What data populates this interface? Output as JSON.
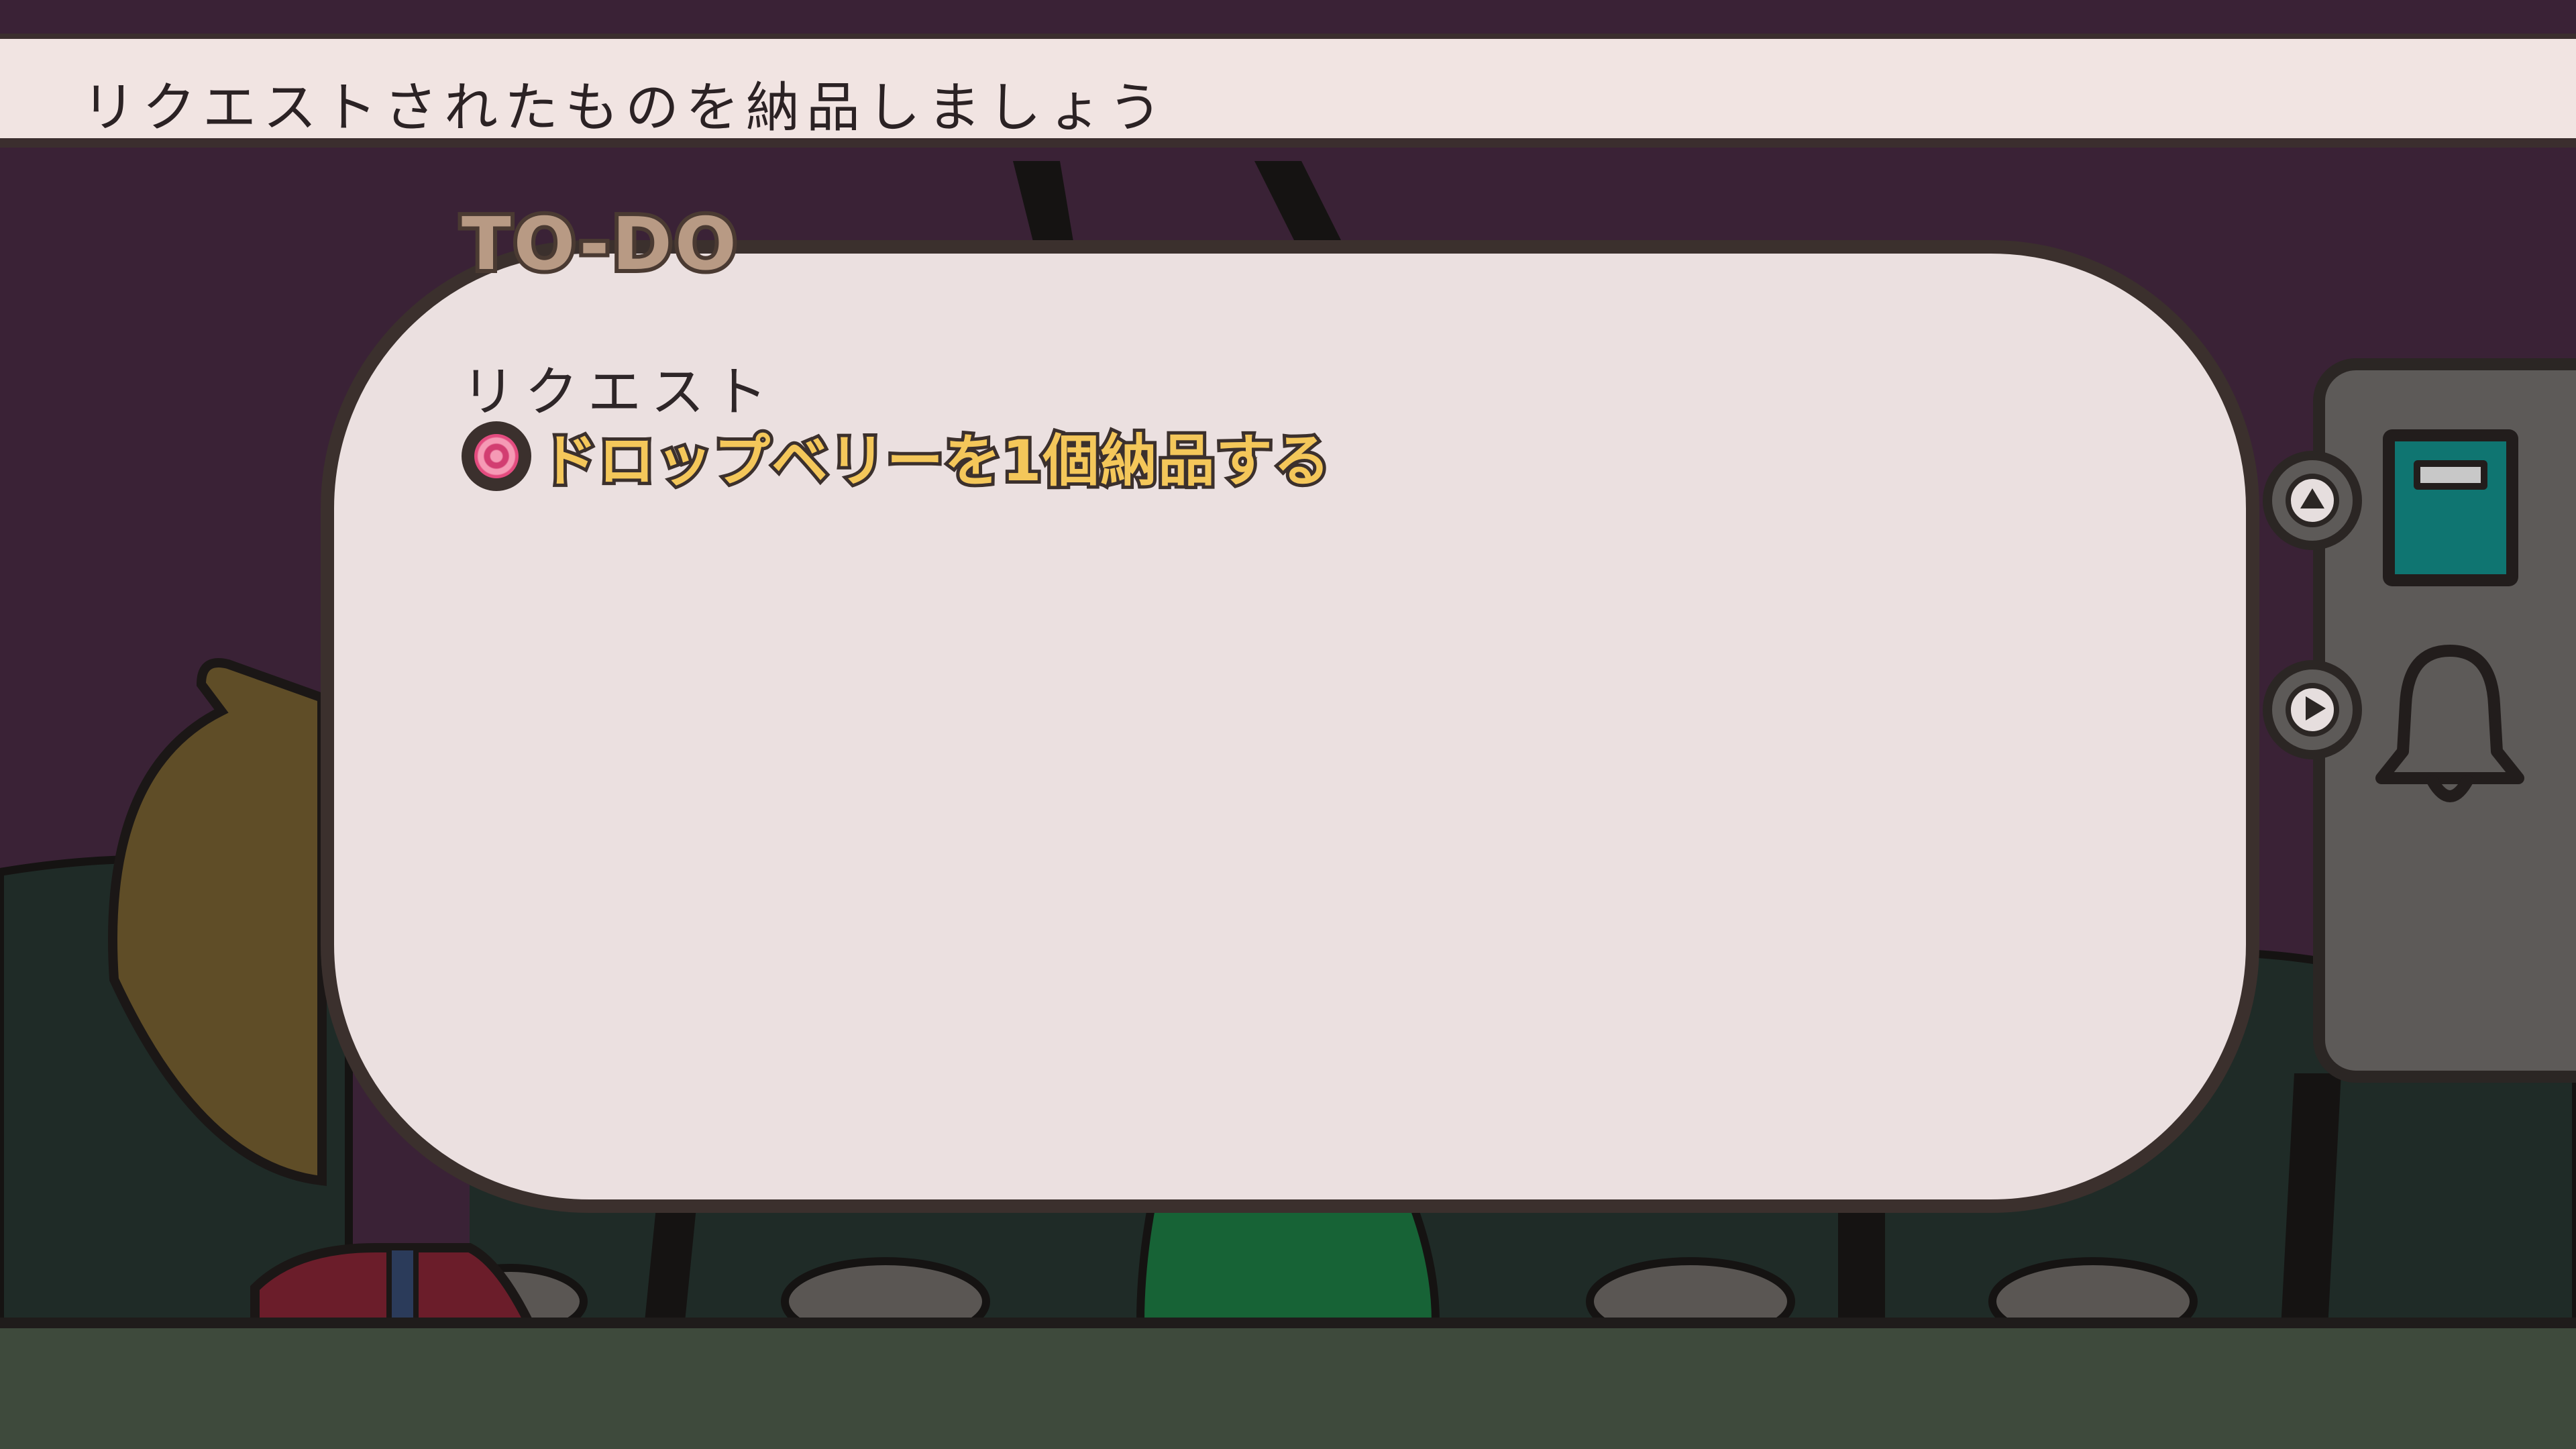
{
  "top_bar": {
    "message": "リクエストされたものを納品しましょう"
  },
  "todo": {
    "tab_label": "TO-DO",
    "section_heading": "リクエスト",
    "items": [
      {
        "icon": "dropberry-icon",
        "text": "ドロップベリーを1個納品する"
      }
    ]
  },
  "side_panel": {
    "buttons": [
      {
        "icon": "triangle-up-icon"
      },
      {
        "icon": "play-icon"
      },
      {
        "icon": "book-icon"
      },
      {
        "icon": "bell-icon"
      }
    ]
  },
  "colors": {
    "background": "#3a2236",
    "panel": "#ebe0e0",
    "outline": "#3b302d",
    "request_text": "#f4c75a",
    "book": "#0f7571",
    "side_panel": "#5d5a58"
  }
}
